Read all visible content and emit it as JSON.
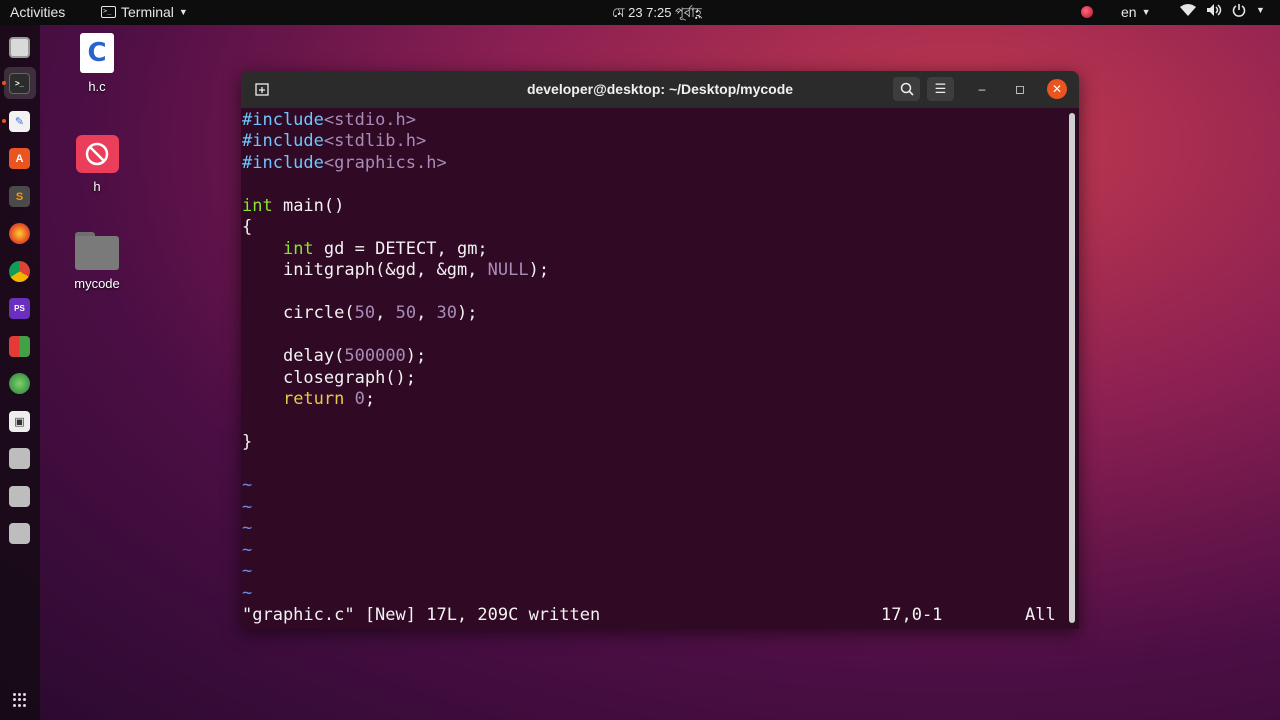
{
  "topbar": {
    "activities": "Activities",
    "app_name": "Terminal",
    "clock": "মে 23  7:25 পূর্বাহ্ণ",
    "lang": "en"
  },
  "desktop": {
    "icons": [
      {
        "label": "h.c",
        "glyph": "C"
      },
      {
        "label": "h"
      },
      {
        "label": "mycode"
      }
    ]
  },
  "window": {
    "title": "developer@desktop: ~/Desktop/mycode"
  },
  "editor": {
    "lines": [
      {
        "pre": "#include",
        "str": "<stdio.h>"
      },
      {
        "pre": "#include",
        "str": "<stdlib.h>"
      },
      {
        "pre": "#include",
        "str": "<graphics.h>"
      },
      {
        "type": "int",
        "rest": " main()"
      },
      {
        "text": "{"
      },
      {
        "indent": "    ",
        "type": "int",
        "rest": " gd = DETECT, gm;"
      },
      {
        "indent": "    ",
        "a": "initgraph(&gd, &gm, ",
        "num": "NULL",
        "b": ");"
      },
      {
        "indent": "    ",
        "a": "circle(",
        "n1": "50",
        "c1": ", ",
        "n2": "50",
        "c2": ", ",
        "n3": "30",
        "b": ");"
      },
      {
        "indent": "    ",
        "a": "delay(",
        "num": "500000",
        "b": ");"
      },
      {
        "indent": "    ",
        "text": "closegraph();"
      },
      {
        "indent": "    ",
        "kw": "return",
        "sp": " ",
        "num": "0",
        "b": ";"
      },
      {
        "text": "}"
      }
    ],
    "tilde": "~",
    "status": {
      "message": "\"graphic.c\" [New] 17L, 209C written",
      "position": "17,0-1",
      "scroll": "All"
    }
  }
}
